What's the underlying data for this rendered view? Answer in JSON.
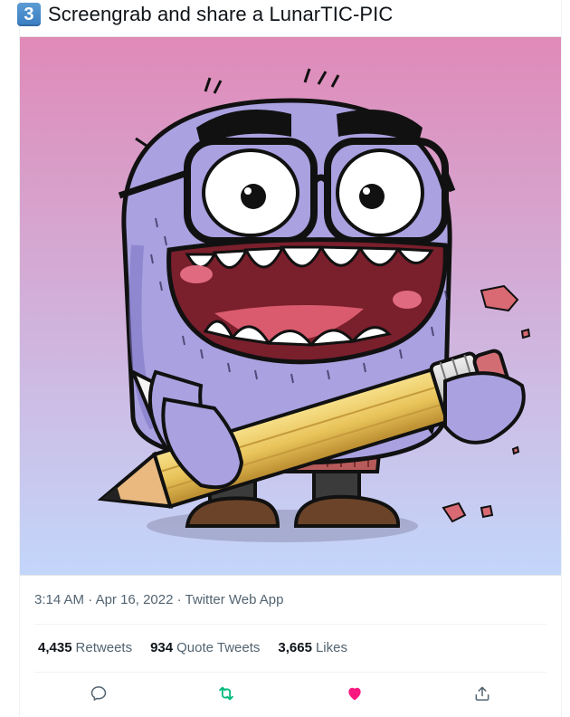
{
  "tweet": {
    "keycap_number": "3",
    "text": "Screengrab and share a LunarTIC-PIC"
  },
  "media": {
    "alt": "LunarTIC-PIC illustration of a purple monster with glasses holding a giant pencil",
    "background_top": "#e08ab8",
    "background_bottom": "#c3d6fb"
  },
  "meta": {
    "time": "3:14 AM",
    "sep1": " · ",
    "date": "Apr 16, 2022",
    "sep2": " · ",
    "source": "Twitter Web App"
  },
  "stats": {
    "retweets_count": "4,435",
    "retweets_label": "Retweets",
    "quotes_count": "934",
    "quotes_label": "Quote Tweets",
    "likes_count": "3,665",
    "likes_label": "Likes"
  },
  "actions": {
    "reply_icon": "reply-icon",
    "retweet_icon": "retweet-icon",
    "like_icon": "heart-icon",
    "share_icon": "share-icon",
    "retweet_color": "#00ba7c",
    "like_color": "#f91880",
    "neutral_color": "#536471"
  }
}
